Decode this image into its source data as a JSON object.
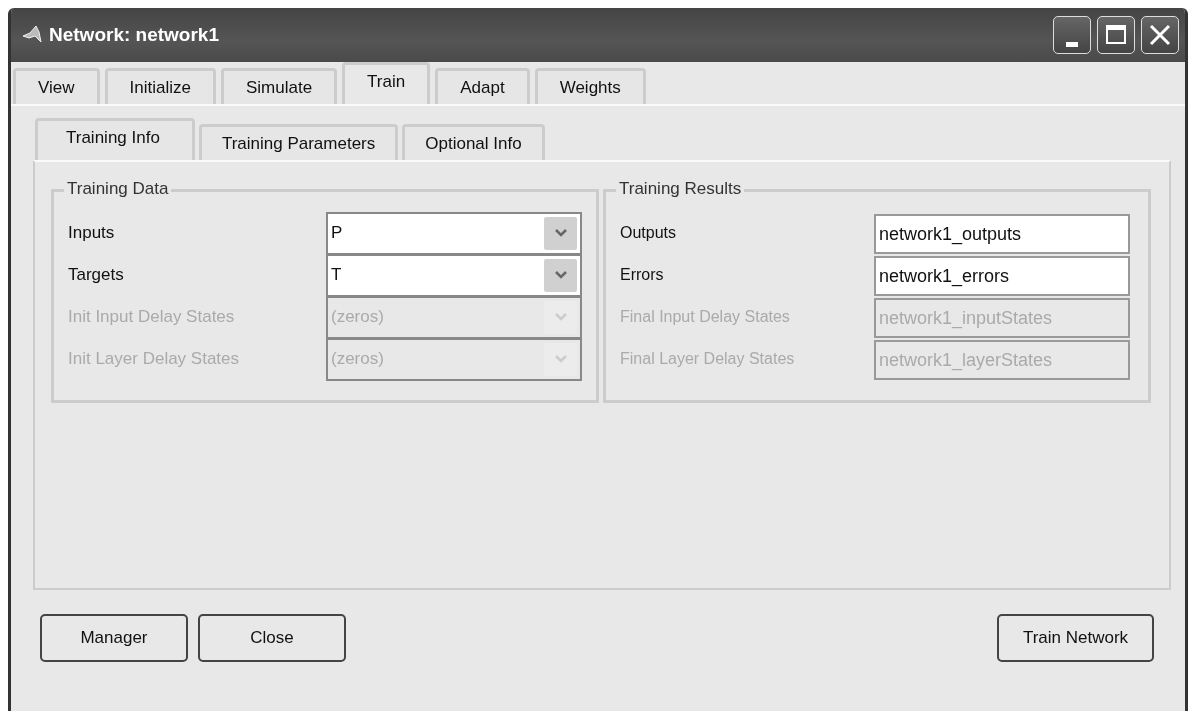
{
  "window": {
    "title": "Network: network1"
  },
  "tabs": [
    {
      "label": "View",
      "selected": false
    },
    {
      "label": "Initialize",
      "selected": false
    },
    {
      "label": "Simulate",
      "selected": false
    },
    {
      "label": "Train",
      "selected": true
    },
    {
      "label": "Adapt",
      "selected": false
    },
    {
      "label": "Weights",
      "selected": false
    }
  ],
  "subtabs": [
    {
      "label": "Training Info",
      "selected": true
    },
    {
      "label": "Training Parameters",
      "selected": false
    },
    {
      "label": "Optional Info",
      "selected": false
    }
  ],
  "groups": [
    {
      "title": "Training Data",
      "fields": [
        {
          "kind": "combo",
          "label": "Inputs",
          "value": "P",
          "disabled": false
        },
        {
          "kind": "combo",
          "label": "Targets",
          "value": "T",
          "disabled": false
        },
        {
          "kind": "combo",
          "label": "Init Input Delay States",
          "value": "(zeros)",
          "disabled": true
        },
        {
          "kind": "combo",
          "label": "Init Layer Delay States",
          "value": "(zeros)",
          "disabled": true
        }
      ]
    },
    {
      "title": "Training Results",
      "fields": [
        {
          "kind": "text",
          "label": "Outputs",
          "value": "network1_outputs",
          "disabled": false
        },
        {
          "kind": "text",
          "label": "Errors",
          "value": "network1_errors",
          "disabled": false
        },
        {
          "kind": "text",
          "label": "Final Input Delay States",
          "value": "network1_inputStates",
          "disabled": true
        },
        {
          "kind": "text",
          "label": "Final Layer Delay States",
          "value": "network1_layerStates",
          "disabled": true
        }
      ]
    }
  ],
  "buttons": [
    {
      "label": "Manager"
    },
    {
      "label": "Close"
    },
    {
      "label": "Train Network"
    }
  ]
}
